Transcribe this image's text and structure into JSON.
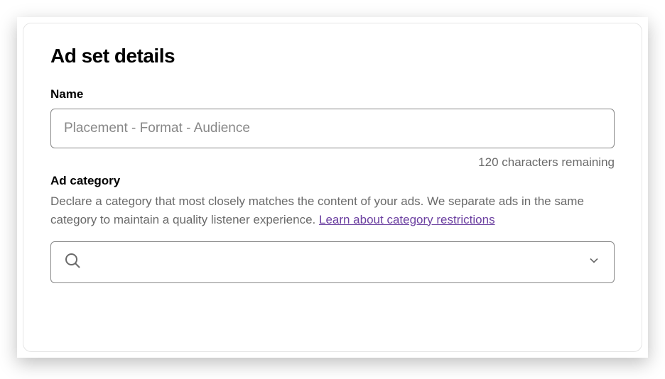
{
  "page": {
    "title": "Ad set details"
  },
  "name_field": {
    "label": "Name",
    "placeholder": "Placement - Format - Audience",
    "char_remaining": "120 characters remaining"
  },
  "category_field": {
    "label": "Ad category",
    "desc_part1": "Declare a category that most closely matches the content of your ads. We separate ads in the same category to maintain a quality listener experience. ",
    "link_text": "Learn about category restrictions"
  }
}
